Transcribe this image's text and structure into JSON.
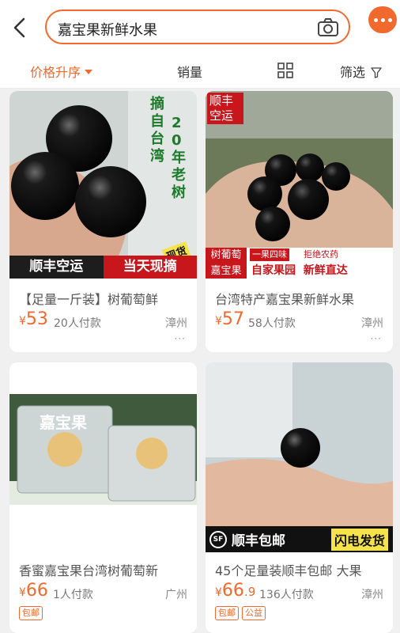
{
  "search": {
    "query": "嘉宝果新鲜水果"
  },
  "filters": {
    "sort_price": "价格升序",
    "sales": "销量",
    "filter": "筛选"
  },
  "products": [
    {
      "title": "【足量一斤装】树葡萄鲜",
      "price_symbol": "¥",
      "price": "53",
      "price_decimal": "",
      "sold": "20人付款",
      "location": "漳州",
      "overlay": {
        "tl": "",
        "vertical_1": "摘自台湾",
        "vertical_2": "20年老树",
        "bottom_left": "顺丰空运",
        "bottom_right": "当天现摘",
        "badge": "现货"
      }
    },
    {
      "title": "台湾特产嘉宝果新鲜水果",
      "price_symbol": "¥",
      "price": "57",
      "price_decimal": "",
      "sold": "58人付款",
      "location": "漳州",
      "overlay": {
        "tl": "顺丰空运",
        "left_stack_1": "树葡萄",
        "left_stack_2": "嘉宝果",
        "sub_1": "一果四味",
        "sub_2": "拒绝农药",
        "bottom": "自家果园  新鲜直达"
      }
    },
    {
      "title": "香蜜嘉宝果台湾树葡萄新",
      "price_symbol": "¥",
      "price": "66",
      "price_decimal": "",
      "sold": "1人付款",
      "location": "广州",
      "tags": [
        "包邮"
      ],
      "overlay": {
        "box_label": "嘉宝果"
      }
    },
    {
      "title": "45个足量装顺丰包邮 大果",
      "price_symbol": "¥",
      "price": "66",
      "price_decimal": ".9",
      "sold": "136人付款",
      "location": "漳州",
      "tags": [
        "包邮",
        "公益"
      ],
      "overlay": {
        "sf_logo": "SF",
        "left": "顺丰包邮",
        "right": "闪电发货"
      }
    }
  ],
  "more_label": "···",
  "colors": {
    "accent": "#f2692d",
    "banner_red": "#c8161d",
    "banner_dark": "#1d1d1d"
  }
}
